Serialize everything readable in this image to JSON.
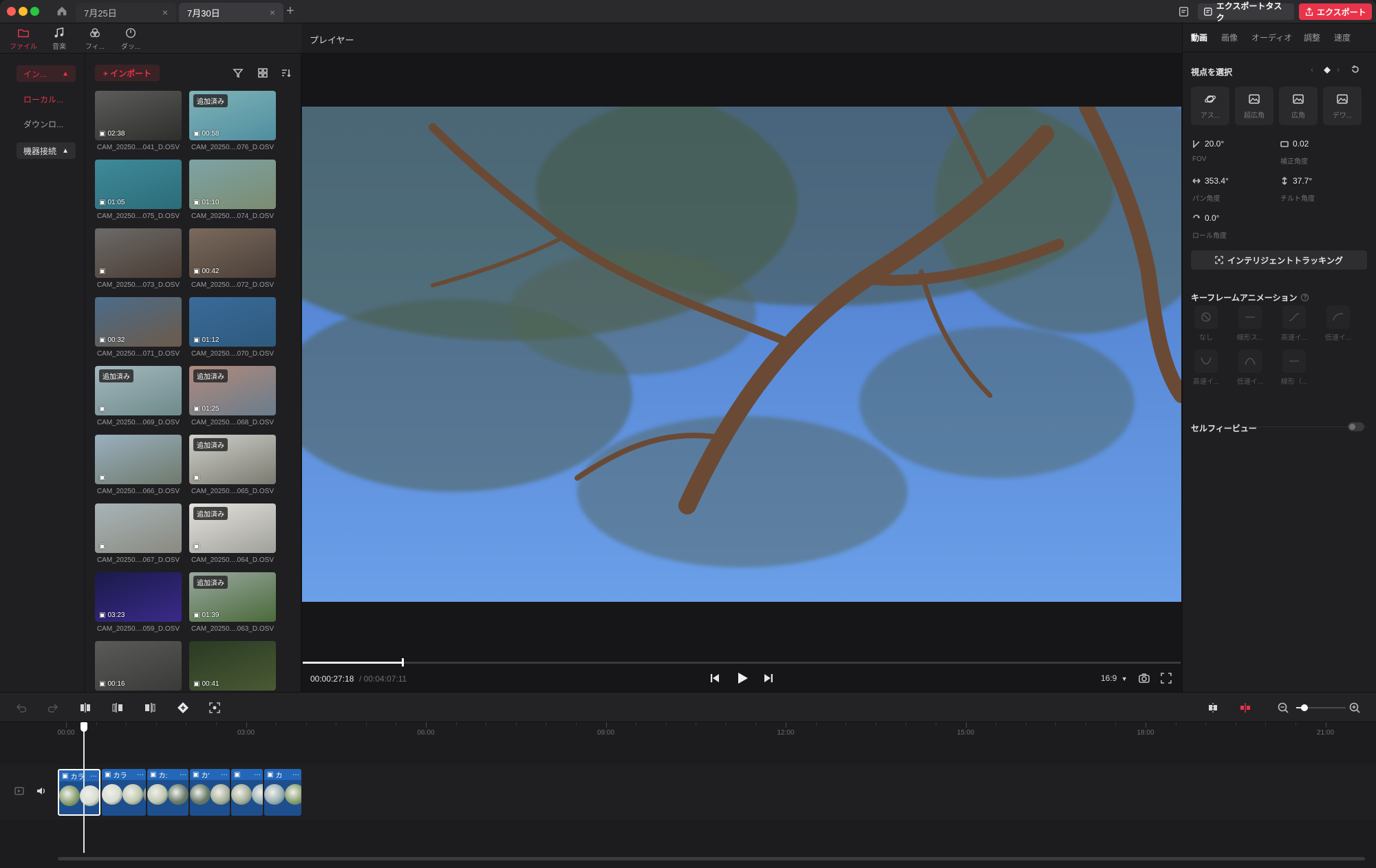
{
  "titlebar": {
    "tabs": [
      {
        "label": "7月25日",
        "close": "×"
      },
      {
        "label": "7月30日",
        "close": "×"
      }
    ],
    "new_tab": "+",
    "export_tasks": "エクスポートタスク",
    "export": "エクスポート"
  },
  "toolbar": {
    "items": [
      {
        "label": "ファイル",
        "icon": "folder-icon"
      },
      {
        "label": "音楽",
        "icon": "music-icon"
      },
      {
        "label": "フィ...",
        "icon": "filter-icon"
      },
      {
        "label": "ダッ...",
        "icon": "dashboard-icon"
      }
    ]
  },
  "sidebar": {
    "import_group": "イン...",
    "local": "ローカル...",
    "downloads": "ダウンロ...",
    "device": "機器接続"
  },
  "media": {
    "import_button": "+ インポート",
    "items": [
      {
        "name": "CAM_20250....041_D.OSV",
        "duration": "02:38",
        "added": ""
      },
      {
        "name": "CAM_20250....076_D.OSV",
        "duration": "00:58",
        "added": "追加済み"
      },
      {
        "name": "CAM_20250....075_D.OSV",
        "duration": "01:05",
        "added": ""
      },
      {
        "name": "CAM_20250....074_D.OSV",
        "duration": "01:10",
        "added": ""
      },
      {
        "name": "CAM_20250....073_D.OSV",
        "duration": "",
        "added": ""
      },
      {
        "name": "CAM_20250....072_D.OSV",
        "duration": "00:42",
        "added": ""
      },
      {
        "name": "CAM_20250....071_D.OSV",
        "duration": "00:32",
        "added": ""
      },
      {
        "name": "CAM_20250....070_D.OSV",
        "duration": "01:12",
        "added": ""
      },
      {
        "name": "CAM_20250....069_D.OSV",
        "duration": "",
        "added": "追加済み"
      },
      {
        "name": "CAM_20250....068_D.OSV",
        "duration": "01:25",
        "added": "追加済み"
      },
      {
        "name": "CAM_20250....066_D.OSV",
        "duration": "",
        "added": ""
      },
      {
        "name": "CAM_20250....065_D.OSV",
        "duration": "",
        "added": "追加済み"
      },
      {
        "name": "CAM_20250....067_D.OSV",
        "duration": "",
        "added": ""
      },
      {
        "name": "CAM_20250....064_D.OSV",
        "duration": "",
        "added": "追加済み"
      },
      {
        "name": "CAM_20250....059_D.OSV",
        "duration": "03:23",
        "added": ""
      },
      {
        "name": "CAM_20250....063_D.OSV",
        "duration": "01:39",
        "added": "追加済み"
      },
      {
        "name": "",
        "duration": "00:16",
        "added": ""
      },
      {
        "name": "",
        "duration": "00:41",
        "added": ""
      }
    ]
  },
  "player": {
    "title": "プレイヤー",
    "current_time": "00:00:27:18",
    "total_time": "/ 00:04:07:11",
    "aspect": "16:9",
    "progress": 0.113
  },
  "right_panel": {
    "tabs": [
      "動画",
      "画像",
      "オーディオ",
      "調整",
      "速度"
    ],
    "view_section": "視点を選択",
    "views": [
      "アス...",
      "超広角",
      "広角",
      "デワ..."
    ],
    "fov_value": "20.0°",
    "fov_label": "FOV",
    "correction_value": "0.02",
    "correction_label": "補正角度",
    "pan_value": "353.4°",
    "pan_label": "パン角度",
    "tilt_value": "37.7°",
    "tilt_label": "チルト角度",
    "roll_value": "0.0°",
    "roll_label": "ロール角度",
    "tracking": "インテリジェントトラッキング",
    "keyframe_section": "キーフレームアニメーション",
    "keyframes": [
      "なし",
      "線形ス...",
      "高速イ...",
      "低速イ...",
      "高速イ...",
      "低速イ...",
      "線形（..."
    ],
    "selfie_view": "セルフィービュー"
  },
  "timeline": {
    "ruler": [
      "00:00",
      "03:00",
      "06:00",
      "09:00",
      "12:00",
      "15:00",
      "18:00",
      "21:00"
    ],
    "clips": [
      "カラ",
      "カラ",
      "カ:",
      "カ'",
      "",
      "カ"
    ]
  },
  "colors": {
    "accent": "#e8344a",
    "clip": "#1d4f8f",
    "sky": "#5a8fe0"
  }
}
